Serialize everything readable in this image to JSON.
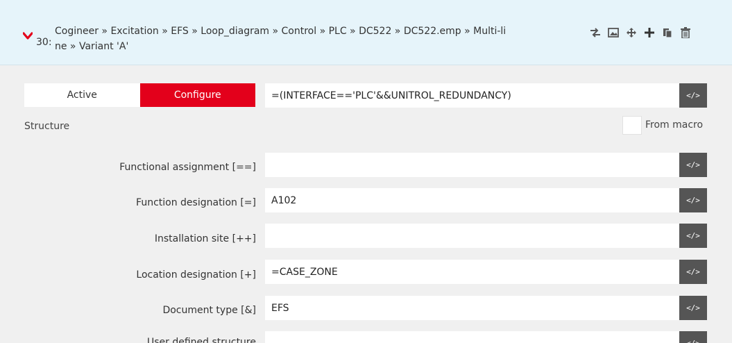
{
  "header": {
    "number": "30:",
    "path_line1": "Cogineer » Excitation » EFS » Loop_diagram » Control » PLC » DC522 » DC522.emp » Multi-li",
    "path_line2": "ne » Variant 'A'",
    "tools": [
      "swap-icon",
      "image-icon",
      "move-icon",
      "plus-icon",
      "copy-icon",
      "trash-icon"
    ]
  },
  "toggle": {
    "active_label": "Active",
    "configure_label": "Configure"
  },
  "condition": {
    "value": "=(INTERFACE=='PLC'&&UNITROL_REDUNDANCY)"
  },
  "code_button_label": "</>",
  "structure": {
    "heading": "Structure",
    "from_macro_label": "From macro"
  },
  "fields": [
    {
      "label": "Functional assignment [==]",
      "value": ""
    },
    {
      "label": "Function designation [=]",
      "value": "A102"
    },
    {
      "label": "Installation site [++]",
      "value": ""
    },
    {
      "label": "Location designation [+]",
      "value": "=CASE_ZONE"
    },
    {
      "label": "Document type [&]",
      "value": "EFS"
    },
    {
      "label": "User defined structure",
      "value": ""
    }
  ],
  "colors": {
    "accent": "#e3001b",
    "header_bg": "#e6f4fa",
    "code_button": "#555555",
    "panel_bg": "#f0f0f0"
  }
}
